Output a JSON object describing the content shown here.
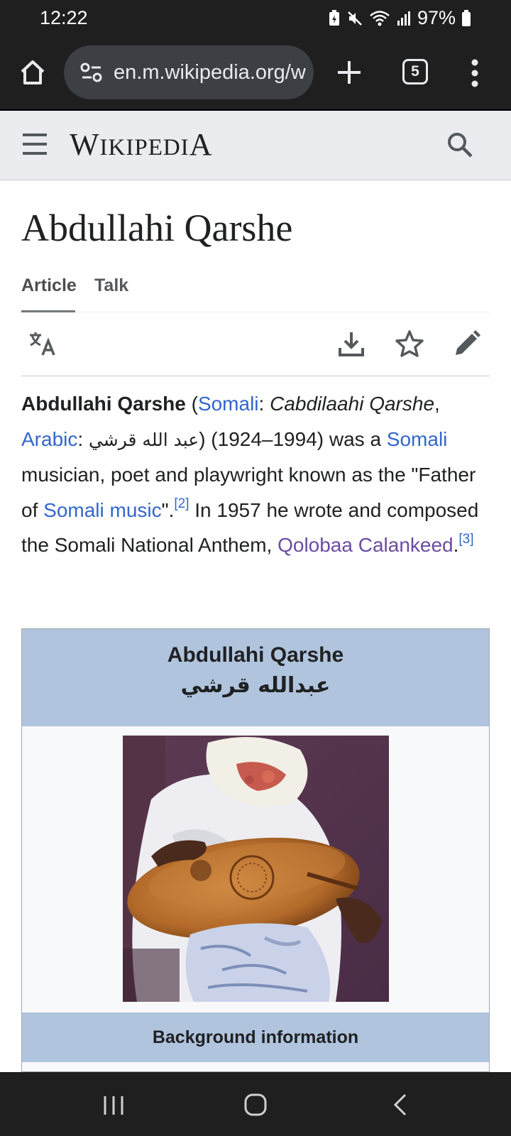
{
  "status_bar": {
    "time": "12:22",
    "battery": "97%"
  },
  "browser": {
    "url": "en.m.wikipedia.org/w",
    "tab_count": "5"
  },
  "wiki_header": {
    "logo_first": "W",
    "logo_mid": "IKIPEDI",
    "logo_last": "A"
  },
  "page": {
    "title": "Abdullahi Qarshe",
    "tabs": [
      "Article",
      "Talk"
    ]
  },
  "intro": {
    "name_bold": "Abdullahi Qarshe",
    "open_paren": " (",
    "link_somali": "Somali",
    "colon1": ": ",
    "somali_name": "Cabdilaahi Qarshe",
    "comma": ",",
    "link_arabic": "Arabic",
    "colon2": ": ",
    "arabic_name": "عبد الله قرشي",
    "dates": ") (1924–1994) was a ",
    "link_somali2": "Somali",
    "desc1": " musician, poet and playwright known as the \"Father of ",
    "link_somali_music": "Somali music",
    "desc2": "\".",
    "ref2": "[2]",
    "desc3": " In 1957 he wrote and composed the Somali National Anthem, ",
    "link_anthem": "Qolobaa Calankeed",
    "period": ".",
    "ref3": "[3]"
  },
  "infobox": {
    "title": "Abdullahi Qarshe",
    "arabic_title": "عبدالله قرشي",
    "section": "Background information"
  },
  "colors": {
    "link": "#3366cc",
    "visited_link": "#6b4ba1",
    "infobox_header": "#b0c4de",
    "header_bg": "#eaecf0",
    "system_bar": "#1f1f1f"
  }
}
